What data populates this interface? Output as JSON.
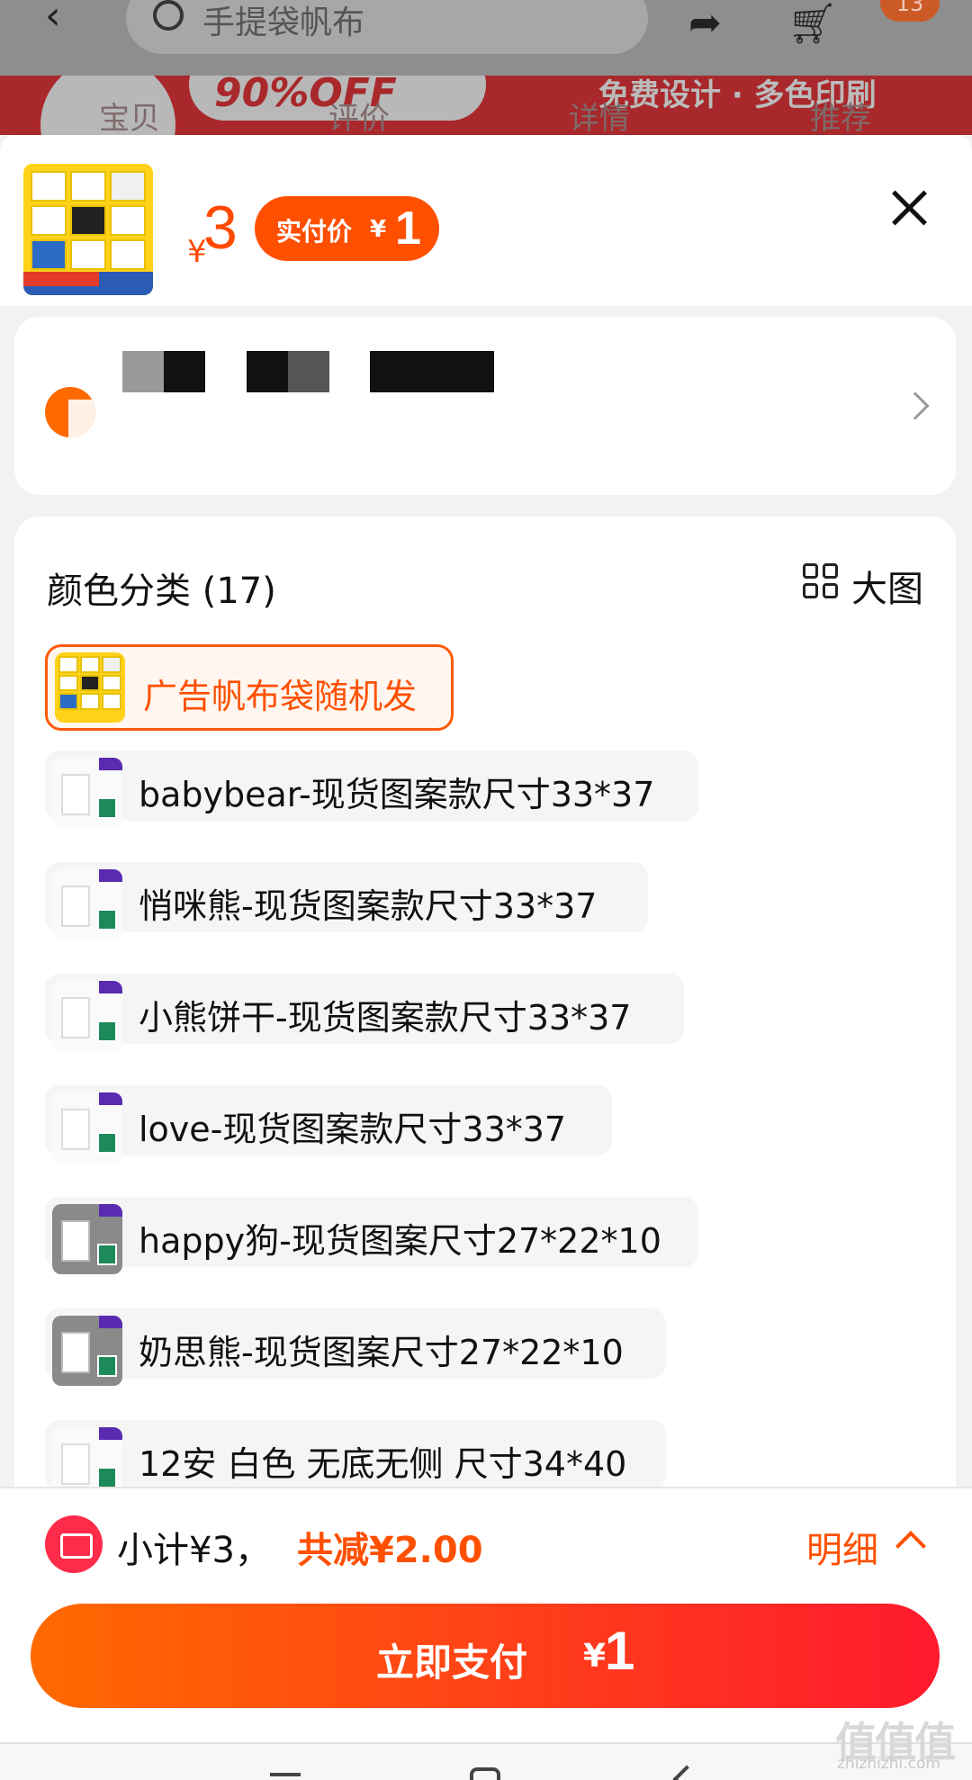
{
  "background": {
    "search_placeholder": "手提袋帆布",
    "cart_badge": "13",
    "banner_text": "90%OFF",
    "banner_right_text": "免费设计 · 多色印刷",
    "tabs": [
      "宝贝",
      "评价",
      "详情",
      "推荐"
    ]
  },
  "product": {
    "currency": "¥",
    "price": "3",
    "pay_price_label": "实付价",
    "pay_price": "1"
  },
  "options": {
    "title": "颜色分类 (17)",
    "big_view_label": "大图",
    "items": [
      {
        "label": "广告帆布袋随机发",
        "selected": true
      },
      {
        "label": "babybear-现货图案款尺寸33*37"
      },
      {
        "label": "悄咪熊-现货图案款尺寸33*37"
      },
      {
        "label": "小熊饼干-现货图案款尺寸33*37"
      },
      {
        "label": "love-现货图案款尺寸33*37"
      },
      {
        "label": "happy狗-现货图案尺寸27*22*10"
      },
      {
        "label": "奶思熊-现货图案尺寸27*22*10"
      },
      {
        "label": "12安 白色 无底无侧 尺寸34*40"
      }
    ]
  },
  "footer": {
    "subtotal": "小计¥3，",
    "saved": "共减¥2.00",
    "detail_label": "明细",
    "pay_label": "立即支付",
    "pay_currency": "¥",
    "pay_value": "1"
  },
  "watermark": {
    "big": "值值值",
    "small": "zhizhizhi.com"
  },
  "colors": {
    "accent": "#ff5000",
    "pay_gradient_start": "#ff6a00",
    "pay_gradient_end": "#ff1a2e"
  },
  "icons": [
    "back-icon",
    "search-icon",
    "share-icon",
    "cart-icon",
    "close-icon",
    "location-icon",
    "chevron-right-icon",
    "grid-icon",
    "coupon-icon",
    "chevron-up-icon"
  ]
}
